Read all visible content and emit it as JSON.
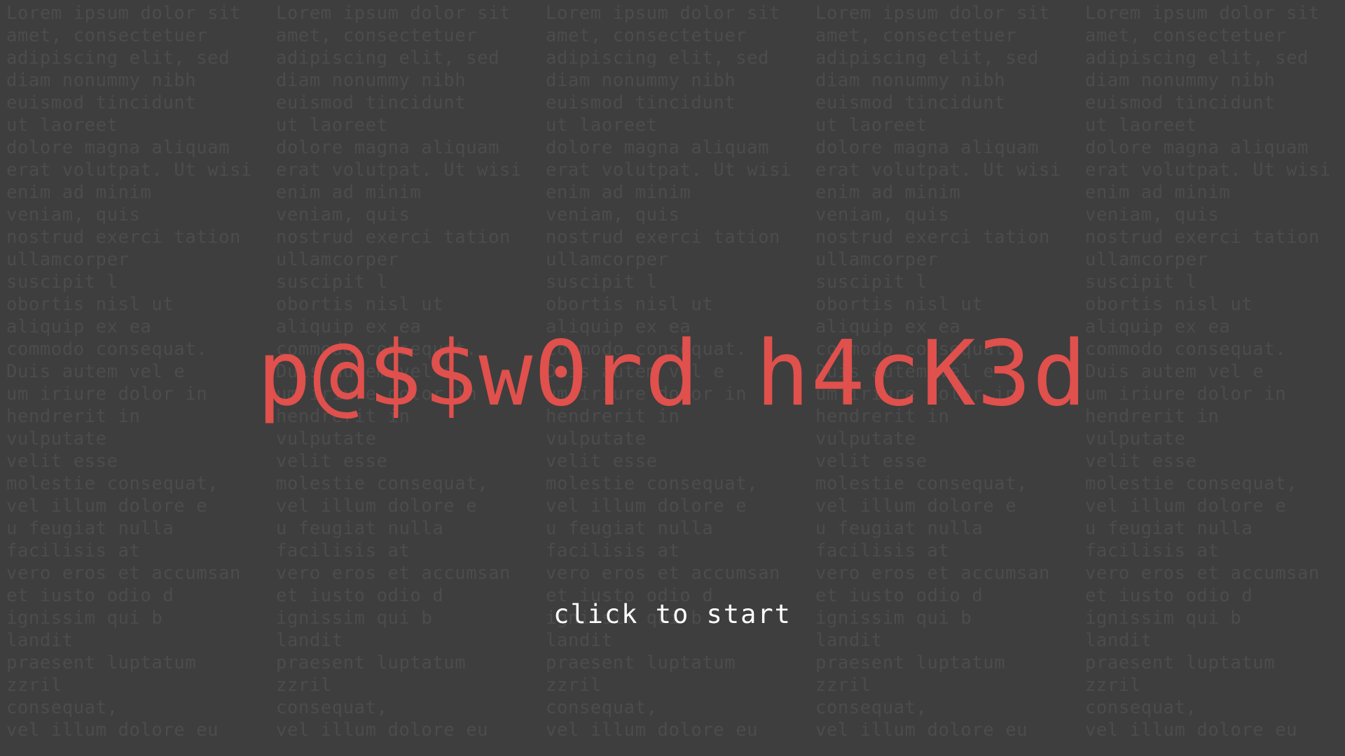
{
  "colors": {
    "background": "#3e3e3e",
    "filler_text": "#4c4c4c",
    "title": "#e0504c",
    "prompt": "#ffffff"
  },
  "background_text": {
    "column_count": 5,
    "lines": [
      "Lorem ipsum dolor sit",
      "amet, consectetuer",
      "adipiscing elit, sed",
      "diam nonummy nibh",
      "euismod tincidunt",
      "ut laoreet",
      "dolore magna aliquam",
      "erat volutpat. Ut wisi",
      "enim ad minim",
      "veniam, quis",
      "nostrud exerci tation",
      "ullamcorper",
      "suscipit l",
      "obortis nisl ut",
      "aliquip ex ea",
      "commodo consequat.",
      "Duis autem vel e",
      "um iriure dolor in",
      "hendrerit in",
      "vulputate",
      "velit esse",
      "molestie consequat,",
      "vel illum dolore e",
      "u feugiat nulla",
      "facilisis at",
      "vero eros et accumsan",
      "et iusto odio d",
      "ignissim qui b",
      "landit",
      "praesent luptatum",
      "zzril",
      "consequat,",
      "vel illum dolore eu"
    ]
  },
  "title": "p@$$w0rd h4cK3d",
  "start_prompt": "click to start"
}
